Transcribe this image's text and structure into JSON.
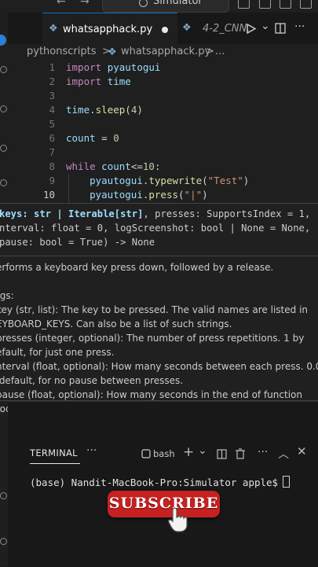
{
  "titlebar": {
    "back_arrow": "←",
    "forward_arrow": "→",
    "search_label": "Simulator"
  },
  "tabs": [
    {
      "label": "whatsapphack.py",
      "modified": true,
      "active": true,
      "icon": "python-file-icon"
    },
    {
      "label": "4-2_CNN.",
      "active": false,
      "icon": "python-file-icon"
    }
  ],
  "breadcrumb": {
    "folder": "pythonscripts",
    "separator": ">",
    "file": "whatsapphack.py",
    "more": "..."
  },
  "editor": {
    "lines": [
      {
        "num": "1",
        "tokens": [
          [
            "kw",
            "import"
          ],
          [
            "op",
            " "
          ],
          [
            "var",
            "pyautogui"
          ]
        ]
      },
      {
        "num": "2",
        "tokens": [
          [
            "kw",
            "import"
          ],
          [
            "op",
            " "
          ],
          [
            "var",
            "time"
          ]
        ]
      },
      {
        "num": "3",
        "tokens": []
      },
      {
        "num": "4",
        "tokens": [
          [
            "var",
            "time"
          ],
          [
            "op",
            "."
          ],
          [
            "fn",
            "sleep"
          ],
          [
            "op",
            "("
          ],
          [
            "num",
            "4"
          ],
          [
            "op",
            ")"
          ]
        ]
      },
      {
        "num": "5",
        "tokens": []
      },
      {
        "num": "6",
        "tokens": [
          [
            "var",
            "count"
          ],
          [
            "op",
            " = "
          ],
          [
            "num",
            "0"
          ]
        ]
      },
      {
        "num": "7",
        "tokens": []
      },
      {
        "num": "8",
        "tokens": [
          [
            "kw",
            "while"
          ],
          [
            "op",
            " "
          ],
          [
            "var",
            "count"
          ],
          [
            "op",
            "<="
          ],
          [
            "num",
            "10"
          ],
          [
            "op",
            ":"
          ]
        ]
      },
      {
        "num": "9",
        "tokens": [
          [
            "op",
            "    "
          ],
          [
            "var",
            "pyautogui"
          ],
          [
            "op",
            "."
          ],
          [
            "fn",
            "typewrite"
          ],
          [
            "op",
            "("
          ],
          [
            "str",
            "\"Test\""
          ],
          [
            "op",
            ")"
          ]
        ]
      },
      {
        "num": "10",
        "tokens": [
          [
            "op",
            "    "
          ],
          [
            "var",
            "pyautogui"
          ],
          [
            "op",
            "."
          ],
          [
            "fn",
            "press"
          ],
          [
            "op",
            "("
          ],
          [
            "str",
            "\"|\""
          ],
          [
            "op",
            ")"
          ]
        ]
      }
    ]
  },
  "hover": {
    "signature_lines": [
      "keys: str | Iterable[str], presses: SupportsIndex = 1,",
      "nterval: float = 0, logScreenshot: bool | None = None,",
      "pause: bool = True) -> None"
    ],
    "doc_lines": [
      "erforms a keyboard key press down, followed by a release.",
      "",
      "rgs:",
      "key (str, list): The key to be pressed. The valid names are listed in",
      "EYBOARD_KEYS. Can also be a list of such strings.",
      "presses (integer, optional): The number of press repetitions. 1 by",
      "efault, for just one press.",
      "nterval (float, optional): How many seconds between each press. 0.0",
      " default, for no pause between presses.",
      "pause (float, optional): How many seconds in the end of function",
      "rocess. None by default, for no pause in the end of function process."
    ]
  },
  "terminal": {
    "tab_label": "TERMINAL",
    "more": "···",
    "shell": "bash",
    "add": "+",
    "chevron": "⌄",
    "prompt": "(base) Nandit-MacBook-Pro:Simulator apple$"
  },
  "overlay": {
    "subscribe_label": "SUBSCRIBE",
    "subscribe_color": "#c62121"
  },
  "colors": {
    "keyword": "#c586c0",
    "function": "#dcdcaa",
    "variable": "#9cdcfe",
    "number": "#b5cea8",
    "string": "#ce9178",
    "accent": "#0e70c0"
  }
}
